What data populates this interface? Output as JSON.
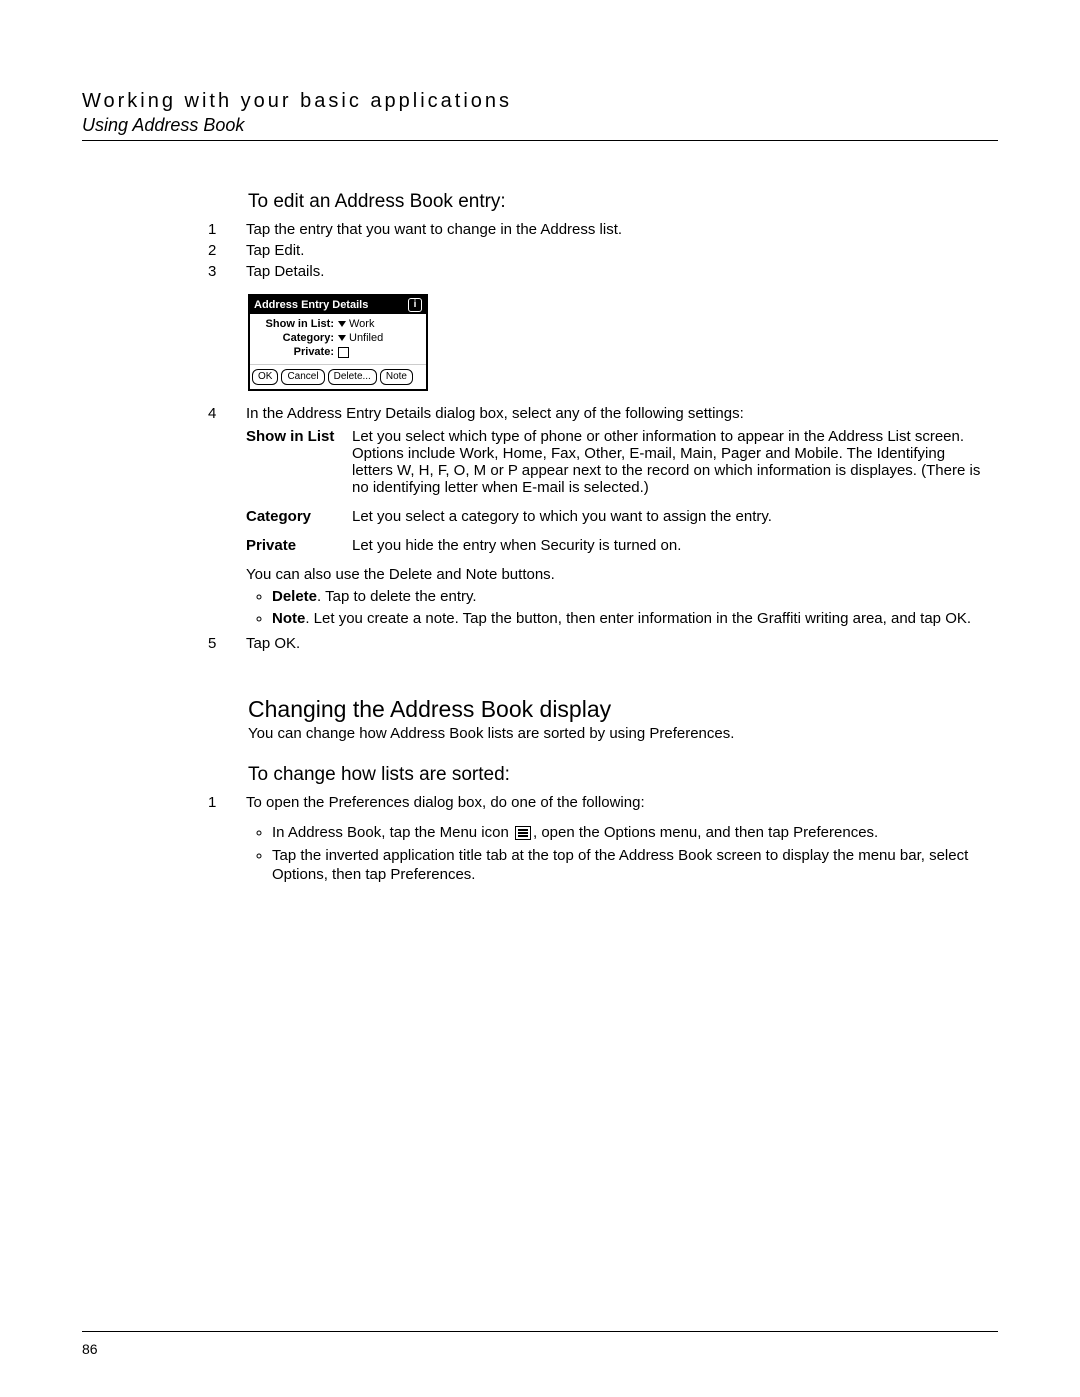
{
  "header": {
    "chapter": "Working with your basic applications",
    "section": "Using Address Book"
  },
  "sub1": {
    "title": "To edit an Address Book entry:",
    "step1": "Tap the entry that you want to change in the Address list.",
    "step2": "Tap Edit.",
    "step3": "Tap Details.",
    "step4_intro": "In the Address Entry Details dialog box, select any of the following settings:",
    "step4_afterpara": "You can also use the Delete and Note buttons.",
    "step5": "Tap OK."
  },
  "figure": {
    "title": "Address Entry Details",
    "row1_label": "Show in List:",
    "row1_value": "Work",
    "row2_label": "Category:",
    "row2_value": "Unfiled",
    "row3_label": "Private:",
    "btn_ok": "OK",
    "btn_cancel": "Cancel",
    "btn_delete": "Delete...",
    "btn_note": "Note"
  },
  "defs": {
    "t1": "Show in List",
    "d1": "Let you select which type of phone or other information to appear in the Address List screen. Options include Work, Home, Fax, Other, E-mail, Main, Pager and Mobile. The Identifying letters W, H, F, O, M or P appear next to the record on which information is displayes. (There is no identifying letter when E-mail is selected.)",
    "t2": "Category",
    "d2": "Let you select a category to which you want to assign the entry.",
    "t3": "Private",
    "d3": "Let you hide the entry when Security is turned on."
  },
  "bullets1": {
    "b1_term": "Delete",
    "b1_rest": ". Tap to delete the entry.",
    "b2_term": "Note",
    "b2_rest": ". Let you create a note. Tap the button, then enter information in the Graffiti writing area, and tap OK."
  },
  "sec2": {
    "title": "Changing the Address Book display",
    "intro": "You can change how Address Book lists are sorted by using Preferences."
  },
  "sub2": {
    "title": "To change how lists are sorted:",
    "step1": "To open the Preferences dialog box, do one of the following:",
    "bp1_pre": "In Address Book, tap the Menu icon ",
    "bp1_post": ", open the Options menu, and then tap Preferences.",
    "bp2": "Tap the inverted application title tab at the top of the Address Book screen to display the menu bar, select Options, then tap Preferences."
  },
  "page_number": "86"
}
